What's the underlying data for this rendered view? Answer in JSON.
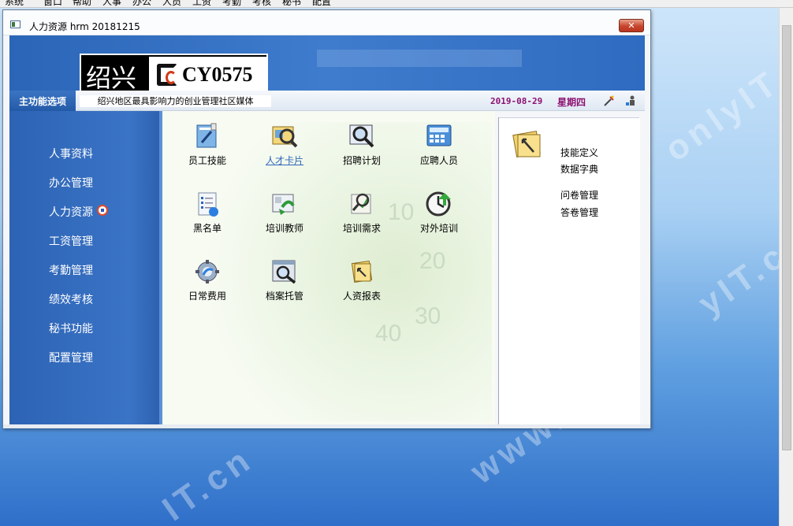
{
  "menubar": {
    "items": [
      "系统",
      "窗口",
      "帮助",
      "人事",
      "办公",
      "人员",
      "工资",
      "考勤",
      "考核",
      "秘书",
      "配置"
    ]
  },
  "window": {
    "title": "人力资源 hrm 20181215",
    "close_label": "✕"
  },
  "logo": {
    "main": "绍兴",
    "code": "CY0575",
    "tagline": "绍兴地区最具影响力的创业管理社区媒体"
  },
  "strip": {
    "label": "主功能选项",
    "date": "2019-08-29",
    "weekday": "星期四"
  },
  "nav": {
    "items": [
      "人事资料",
      "办公管理",
      "人力资源",
      "工资管理",
      "考勤管理",
      "绩效考核",
      "秘书功能",
      "配置管理"
    ]
  },
  "tiles": {
    "items": [
      {
        "label": "员工技能",
        "icon": "skills-icon"
      },
      {
        "label": "人才卡片",
        "icon": "talent-card-icon"
      },
      {
        "label": "招聘计划",
        "icon": "recruit-plan-icon"
      },
      {
        "label": "应聘人员",
        "icon": "applicant-icon"
      },
      {
        "label": "黑名单",
        "icon": "blacklist-icon"
      },
      {
        "label": "培训教师",
        "icon": "trainer-icon"
      },
      {
        "label": "培训需求",
        "icon": "training-need-icon"
      },
      {
        "label": "对外培训",
        "icon": "external-training-icon"
      },
      {
        "label": "日常费用",
        "icon": "daily-expense-icon"
      },
      {
        "label": "档案托管",
        "icon": "archive-icon"
      },
      {
        "label": "人资报表",
        "icon": "hr-report-icon"
      }
    ]
  },
  "right_panel": {
    "links": [
      "技能定义",
      "数据字典",
      "问卷管理",
      "答卷管理"
    ]
  },
  "colors": {
    "nav_blue": "#3a74c6",
    "date_purple": "#8b1070",
    "link_blue": "#2f67b8"
  }
}
